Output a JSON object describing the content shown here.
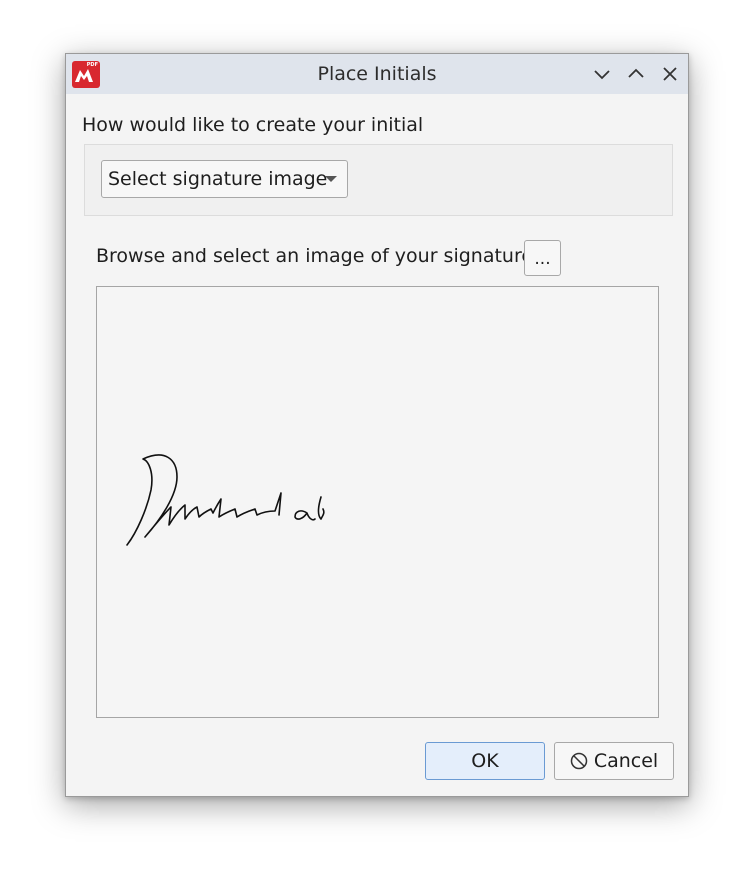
{
  "window": {
    "title": "Place Initials",
    "app_icon_tag": "PDF"
  },
  "form": {
    "question": "How would like to create your initials?",
    "method_select_value": "Select signature image",
    "browse_label": "Browse and select an image of your signature",
    "browse_button_label": "..."
  },
  "footer": {
    "ok_label": "OK",
    "cancel_label": "Cancel"
  },
  "icons": {
    "app": "master-pdf-icon",
    "minimize": "chevron-down-icon",
    "maximize": "chevron-up-icon",
    "close": "close-icon",
    "cancel": "cancel-circle-icon"
  },
  "colors": {
    "app_icon": "#d8282f",
    "ok_button_border": "#6a9ad3",
    "titlebar": "#dfe4ec"
  }
}
